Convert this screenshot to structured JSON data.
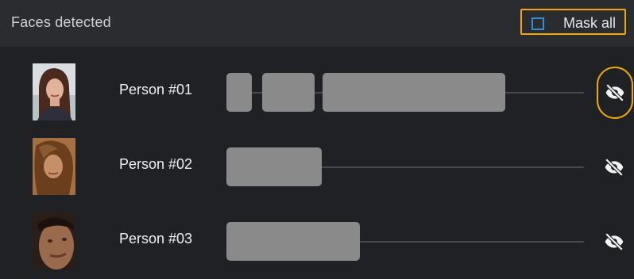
{
  "header": {
    "title": "Faces detected",
    "mask_all_label": "Mask all",
    "mask_all_checked": false
  },
  "faces": [
    {
      "name": "Person #01",
      "masked": false,
      "visibility_icon": "eye-off-icon",
      "highlighted": true
    },
    {
      "name": "Person #02",
      "masked": false,
      "visibility_icon": "eye-off-icon",
      "highlighted": false
    },
    {
      "name": "Person #03",
      "masked": false,
      "visibility_icon": "eye-off-icon",
      "highlighted": false
    }
  ],
  "colors": {
    "background": "#1f2124",
    "header_background": "#2a2c2f",
    "segment": "#8a8a8a",
    "highlight": "#f2a900",
    "checkbox_border": "#2f8fd8",
    "track": "#45484c"
  }
}
